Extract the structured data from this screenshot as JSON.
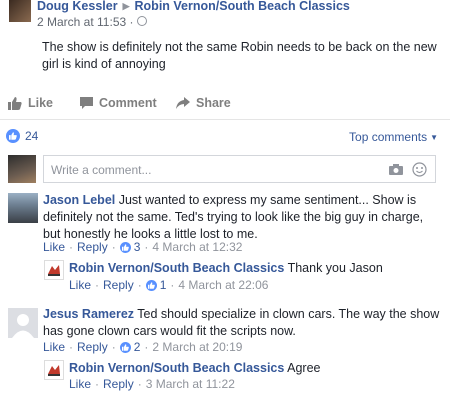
{
  "post": {
    "author": "Doug Kessler",
    "page": "Robin Vernon/South Beach Classics",
    "time": "2 March at 11:53 ·",
    "text": "The show is definitely not the same Robin needs to be back on the new girl is kind of annoying"
  },
  "actions": {
    "like": "Like",
    "comment": "Comment",
    "share": "Share"
  },
  "reactions": {
    "count": "24",
    "top_comments": "Top comments"
  },
  "composer": {
    "placeholder": "Write a comment..."
  },
  "comments": [
    {
      "name": "Jason Lebel",
      "text": "Just wanted to express my same sentiment... Show is definitely not the same. Ted's trying to look like the big guy in charge, but honestly he looks a little lost to me.",
      "like": "Like",
      "reply": "Reply",
      "likes": "3",
      "time": "4 March at 12:32",
      "reply_comment": {
        "name": "Robin Vernon/South Beach Classics",
        "text": "Thank you Jason",
        "like": "Like",
        "reply": "Reply",
        "likes": "1",
        "time": "4 March at 22:06"
      }
    },
    {
      "name": "Jesus Ramerez",
      "text": "Ted should specialize in clown cars. The way the show has gone clown cars would fit the scripts now.",
      "like": "Like",
      "reply": "Reply",
      "likes": "2",
      "time": "2 March at 20:19",
      "reply_comment": {
        "name": "Robin Vernon/South Beach Classics",
        "text": "Agree",
        "like": "Like",
        "reply": "Reply",
        "time": "3 March at 11:22"
      }
    }
  ],
  "colors": {
    "link": "#365899",
    "like_blue": "#5890ff",
    "muted": "#90949c"
  }
}
